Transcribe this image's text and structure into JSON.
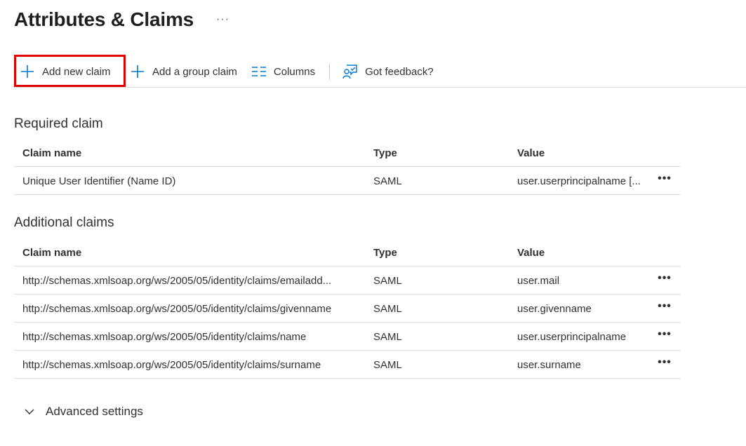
{
  "page": {
    "title": "Attributes & Claims",
    "more": "···"
  },
  "toolbar": {
    "add_new_claim": "Add new claim",
    "add_group_claim": "Add a group claim",
    "columns": "Columns",
    "feedback": "Got feedback?"
  },
  "colors": {
    "accent": "#0078d4",
    "highlight": "#e00000"
  },
  "required": {
    "section_title": "Required claim",
    "headers": {
      "name": "Claim name",
      "type": "Type",
      "value": "Value"
    },
    "rows": [
      {
        "name": "Unique User Identifier (Name ID)",
        "type": "SAML",
        "value": "user.userprincipalname [...",
        "more": "•••"
      }
    ]
  },
  "additional": {
    "section_title": "Additional claims",
    "headers": {
      "name": "Claim name",
      "type": "Type",
      "value": "Value"
    },
    "rows": [
      {
        "name": "http://schemas.xmlsoap.org/ws/2005/05/identity/claims/emailadd...",
        "type": "SAML",
        "value": "user.mail",
        "more": "•••"
      },
      {
        "name": "http://schemas.xmlsoap.org/ws/2005/05/identity/claims/givenname",
        "type": "SAML",
        "value": "user.givenname",
        "more": "•••"
      },
      {
        "name": "http://schemas.xmlsoap.org/ws/2005/05/identity/claims/name",
        "type": "SAML",
        "value": "user.userprincipalname",
        "more": "•••"
      },
      {
        "name": "http://schemas.xmlsoap.org/ws/2005/05/identity/claims/surname",
        "type": "SAML",
        "value": "user.surname",
        "more": "•••"
      }
    ]
  },
  "advanced": {
    "label": "Advanced settings"
  },
  "icons": {
    "add": "plus-icon",
    "columns": "columns-icon",
    "feedback": "feedback-icon",
    "expand": "chevron-down-icon"
  }
}
